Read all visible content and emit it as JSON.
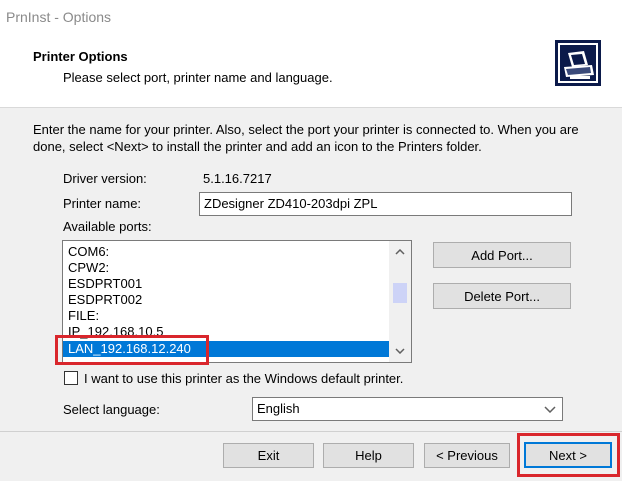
{
  "window": {
    "title": "PrnInst - Options"
  },
  "header": {
    "title": "Printer Options",
    "subtitle": "Please select port, printer name and language.",
    "icon": "printer-wizard-icon"
  },
  "intro": "Enter the name for your printer. Also, select the port your printer is connected to. When you are done, select <Next> to install the printer and add an icon to the Printers folder.",
  "driver": {
    "label": "Driver version:",
    "value": "5.1.16.7217"
  },
  "printer_name": {
    "label": "Printer name:",
    "value": "ZDesigner ZD410-203dpi ZPL"
  },
  "ports": {
    "label": "Available ports:",
    "items": [
      "COM6:",
      "CPW2:",
      "ESDPRT001",
      "ESDPRT002",
      "FILE:",
      "IP_192.168.10.5",
      "LAN_192.168.12.240"
    ],
    "selected": "LAN_192.168.12.240"
  },
  "buttons": {
    "add_port": "Add Port...",
    "delete_port": "Delete Port...",
    "exit": "Exit",
    "help": "Help",
    "previous": "< Previous",
    "next": "Next >"
  },
  "default_printer": {
    "label": "I want to use this printer as the Windows default printer.",
    "checked": false
  },
  "language": {
    "label": "Select language:",
    "value": "English"
  },
  "colors": {
    "highlight": "#d9262c",
    "selection": "#0078d7",
    "accent_border": "#0078d7"
  }
}
